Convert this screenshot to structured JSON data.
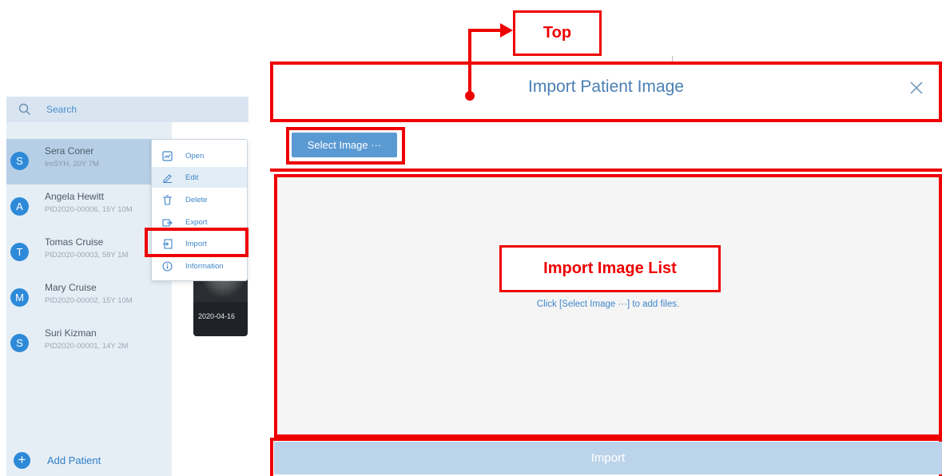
{
  "sidebar": {
    "search_placeholder": "Search",
    "patients": [
      {
        "initial": "S",
        "name": "Sera Coner",
        "sub": "ImSYH, 20Y 7M",
        "selected": true
      },
      {
        "initial": "A",
        "name": "Angela Hewitt",
        "sub": "PID2020-00006, 15Y 10M",
        "selected": false
      },
      {
        "initial": "T",
        "name": "Tomas Cruise",
        "sub": "PID2020-00003, 58Y 1M",
        "selected": false
      },
      {
        "initial": "M",
        "name": "Mary Cruise",
        "sub": "PID2020-00002, 15Y 10M",
        "selected": false
      },
      {
        "initial": "S",
        "name": "Suri Kizman",
        "sub": "PID2020-00001, 14Y 2M",
        "selected": false
      }
    ],
    "add_icon": "+",
    "add_label": "Add Patient"
  },
  "thumbnail": {
    "date": "2020-04-16"
  },
  "context_menu": {
    "items": [
      {
        "label": "Open",
        "icon": "open-icon"
      },
      {
        "label": "Edit",
        "icon": "edit-icon"
      },
      {
        "label": "Delete",
        "icon": "delete-icon"
      },
      {
        "label": "Export",
        "icon": "export-icon"
      },
      {
        "label": "Import",
        "icon": "import-icon"
      },
      {
        "label": "Information",
        "icon": "information-icon"
      }
    ]
  },
  "dialog": {
    "title": "Import Patient Image",
    "select_button": "Select Image ···",
    "hint": "Click [Select Image ···] to add files.",
    "import_button": "Import"
  },
  "annotations": {
    "top": "Top",
    "list": "Import Image List"
  },
  "colors": {
    "accent": "#2e8ad8",
    "highlight": "#ee0000"
  }
}
